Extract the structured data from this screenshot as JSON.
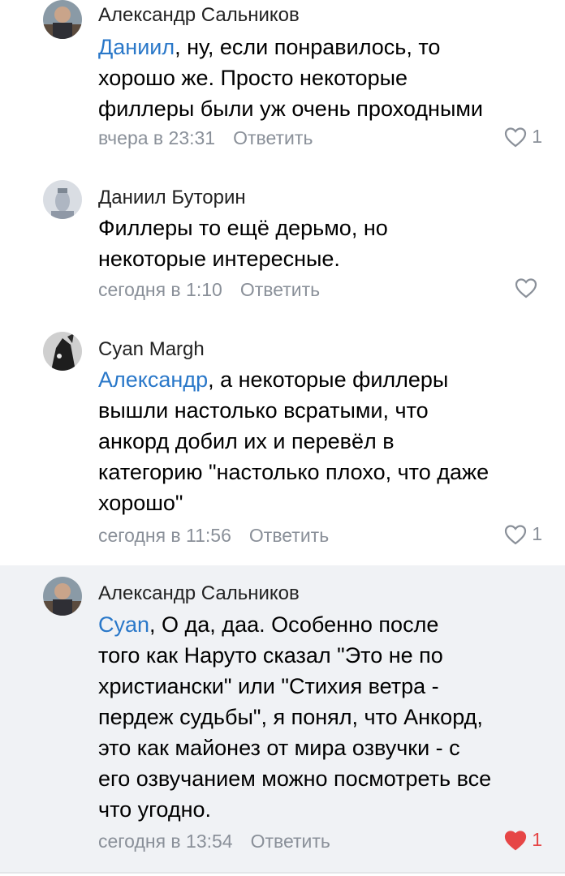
{
  "comments": [
    {
      "author": "Александр Сальников",
      "mention": "Даниил",
      "lines": [
        ", ну, если понравилось, то",
        "хорошо же. Просто некоторые",
        "филлеры были уж очень проходными"
      ],
      "time": "вчера в 23:31",
      "reply": "Ответить",
      "likes": "1",
      "liked": false
    },
    {
      "author": "Даниил Буторин",
      "mention": "",
      "lines": [
        "Филлеры то ещё дерьмо, но",
        "некоторые интересные."
      ],
      "time": "сегодня в 1:10",
      "reply": "Ответить",
      "likes": "",
      "liked": false
    },
    {
      "author": "Cyan Margh",
      "mention": "Александр",
      "lines": [
        ", а некоторые филлеры",
        "вышли настолько всратыми, что",
        "анкорд добил их и перевёл в",
        "категорию \"настолько плохо, что даже",
        "хорошо\""
      ],
      "time": "сегодня в 11:56",
      "reply": "Ответить",
      "likes": "1",
      "liked": false
    },
    {
      "author": "Александр Сальников",
      "mention": "Cyan",
      "lines": [
        ", О да, даа. Особенно после",
        "того как Наруто сказал \"Это не по",
        "христиански\" или \"Стихия ветра -",
        "пердеж судьбы\", я понял, что Анкорд,",
        "это как майонез от мира озвучки - с",
        "его озвучанием можно посмотреть все",
        "что угодно."
      ],
      "time": "сегодня в 13:54",
      "reply": "Ответить",
      "likes": "1",
      "liked": true
    }
  ],
  "colors": {
    "mention": "#2a78c9",
    "meta": "#8a9099",
    "liked_heart": "#e64646",
    "highlight_bg": "#f0f2f5"
  }
}
